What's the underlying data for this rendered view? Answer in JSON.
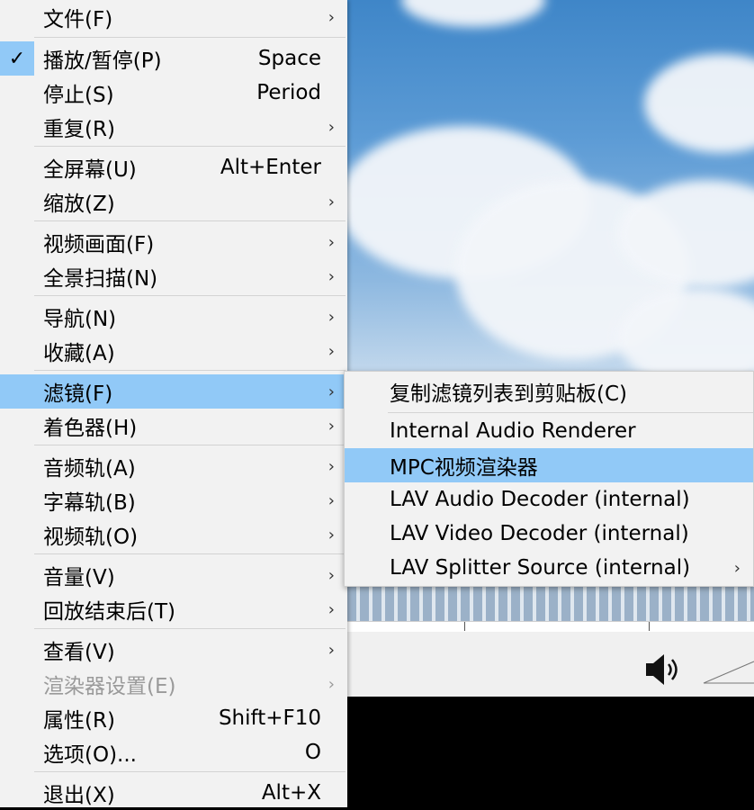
{
  "main_menu": {
    "items": [
      {
        "label": "文件(F)",
        "shortcut": "",
        "submenu": true
      },
      {
        "label": "播放/暂停(P)",
        "shortcut": "Space",
        "checked": true
      },
      {
        "label": "停止(S)",
        "shortcut": "Period"
      },
      {
        "label": "重复(R)",
        "shortcut": "",
        "submenu": true
      },
      {
        "label": "全屏幕(U)",
        "shortcut": "Alt+Enter"
      },
      {
        "label": "缩放(Z)",
        "shortcut": "",
        "submenu": true
      },
      {
        "label": "视频画面(F)",
        "shortcut": "",
        "submenu": true
      },
      {
        "label": "全景扫描(N)",
        "shortcut": "",
        "submenu": true
      },
      {
        "label": "导航(N)",
        "shortcut": "",
        "submenu": true
      },
      {
        "label": "收藏(A)",
        "shortcut": "",
        "submenu": true
      },
      {
        "label": "滤镜(F)",
        "shortcut": "",
        "submenu": true,
        "highlighted": true
      },
      {
        "label": "着色器(H)",
        "shortcut": "",
        "submenu": true
      },
      {
        "label": "音频轨(A)",
        "shortcut": "",
        "submenu": true
      },
      {
        "label": "字幕轨(B)",
        "shortcut": "",
        "submenu": true
      },
      {
        "label": "视频轨(O)",
        "shortcut": "",
        "submenu": true
      },
      {
        "label": "音量(V)",
        "shortcut": "",
        "submenu": true
      },
      {
        "label": "回放结束后(T)",
        "shortcut": "",
        "submenu": true
      },
      {
        "label": "查看(V)",
        "shortcut": "",
        "submenu": true
      },
      {
        "label": "渲染器设置(E)",
        "shortcut": "",
        "submenu": true,
        "disabled": true
      },
      {
        "label": "属性(R)",
        "shortcut": "Shift+F10"
      },
      {
        "label": "选项(O)...",
        "shortcut": "O"
      },
      {
        "label": "退出(X)",
        "shortcut": "Alt+X"
      }
    ],
    "checkmark": "✓",
    "arrow": "›"
  },
  "filter_submenu": {
    "items": [
      {
        "label": "复制滤镜列表到剪贴板(C)"
      },
      {
        "label": "Internal Audio Renderer"
      },
      {
        "label": "MPC视频渲染器",
        "highlighted": true
      },
      {
        "label": "LAV Audio Decoder (internal)"
      },
      {
        "label": "LAV Video Decoder (internal)"
      },
      {
        "label": "LAV Splitter Source (internal)",
        "submenu": true
      }
    ]
  },
  "colors": {
    "highlight": "#91c9f7",
    "menu_bg": "#f2f2f2",
    "disabled_text": "#9a9a9a"
  },
  "icons": {
    "volume": "speaker-icon",
    "check": "checkmark-icon",
    "submenu": "chevron-right-icon"
  }
}
